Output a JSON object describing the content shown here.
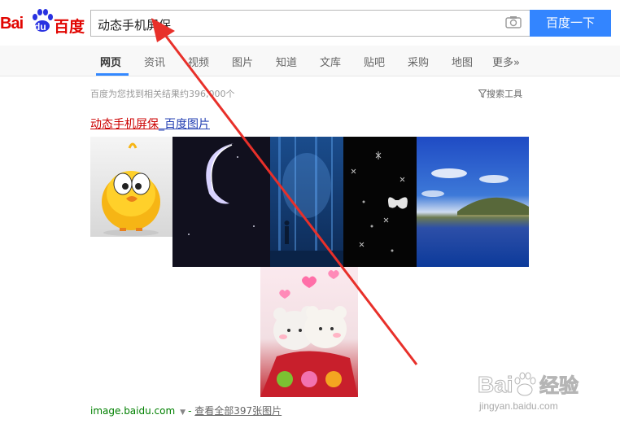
{
  "header": {
    "logo": {
      "latin_a": "Bai",
      "latin_b": "du",
      "chinese": "百度"
    },
    "search": {
      "query": "动态手机屏保",
      "camera_icon": "camera-icon",
      "button_label": "百度一下"
    }
  },
  "nav": {
    "items": [
      {
        "label": "网页",
        "active": true
      },
      {
        "label": "资讯"
      },
      {
        "label": "视频"
      },
      {
        "label": "图片"
      },
      {
        "label": "知道"
      },
      {
        "label": "文库"
      },
      {
        "label": "贴吧"
      },
      {
        "label": "采购"
      },
      {
        "label": "地图"
      },
      {
        "label": "更多»"
      }
    ]
  },
  "results": {
    "count_text": "百度为您找到相关结果约396,000个",
    "tools_label": "搜索工具",
    "tools_icon": "funnel-icon",
    "first": {
      "title_highlight": "动态手机屏保",
      "title_rest": "_百度图片",
      "images": [
        "chick-cartoon-image",
        "crescent-moon-image",
        "blue-forest-image",
        "butterfly-snowflake-image",
        "lake-landscape-image",
        "teddy-bears-image"
      ],
      "source_domain": "image.baidu.com",
      "dropdown_glyph": "▼",
      "source_separator": "-",
      "more_link": "查看全部397张图片"
    }
  },
  "watermark": {
    "brand": "Bai",
    "brand_cn": "经验",
    "url": "jingyan.baidu.com"
  },
  "colors": {
    "brand_red": "#e10602",
    "accent_blue": "#3385ff",
    "link_blue": "#2440b3",
    "highlight_red": "#cc0000",
    "url_green": "#008000",
    "annotation_arrow": "#e8302a"
  }
}
